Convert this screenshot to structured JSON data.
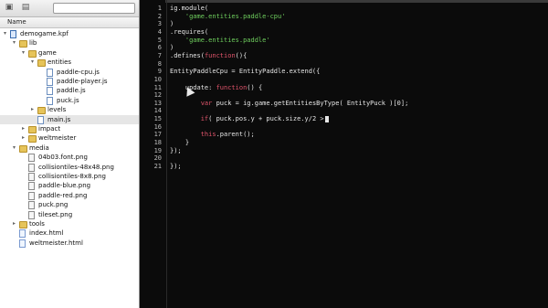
{
  "sidebar": {
    "column_header": "Name",
    "items": [
      {
        "label": "demogame.kpf",
        "type": "kpf",
        "depth": 0,
        "expanded": true
      },
      {
        "label": "lib",
        "type": "folder",
        "depth": 1,
        "expanded": true
      },
      {
        "label": "game",
        "type": "folder",
        "depth": 2,
        "expanded": true
      },
      {
        "label": "entities",
        "type": "folder",
        "depth": 3,
        "expanded": true
      },
      {
        "label": "paddle-cpu.js",
        "type": "js",
        "depth": 4
      },
      {
        "label": "paddle-player.js",
        "type": "js",
        "depth": 4
      },
      {
        "label": "paddle.js",
        "type": "js",
        "depth": 4
      },
      {
        "label": "puck.js",
        "type": "js",
        "depth": 4
      },
      {
        "label": "levels",
        "type": "folder",
        "depth": 3,
        "expanded": false
      },
      {
        "label": "main.js",
        "type": "js",
        "depth": 3,
        "selected": true
      },
      {
        "label": "impact",
        "type": "folder",
        "depth": 2,
        "expanded": false
      },
      {
        "label": "weltmeister",
        "type": "folder",
        "depth": 2,
        "expanded": false
      },
      {
        "label": "media",
        "type": "folder",
        "depth": 1,
        "expanded": true
      },
      {
        "label": "04b03.font.png",
        "type": "png",
        "depth": 2
      },
      {
        "label": "collisiontiles-48x48.png",
        "type": "png",
        "depth": 2
      },
      {
        "label": "collisiontiles-8x8.png",
        "type": "png",
        "depth": 2
      },
      {
        "label": "paddle-blue.png",
        "type": "png",
        "depth": 2
      },
      {
        "label": "paddle-red.png",
        "type": "png",
        "depth": 2
      },
      {
        "label": "puck.png",
        "type": "png",
        "depth": 2
      },
      {
        "label": "tileset.png",
        "type": "png",
        "depth": 2
      },
      {
        "label": "tools",
        "type": "folder",
        "depth": 1,
        "expanded": false
      },
      {
        "label": "index.html",
        "type": "html",
        "depth": 1
      },
      {
        "label": "weltmeister.html",
        "type": "html",
        "depth": 1
      }
    ]
  },
  "editor": {
    "lines": [
      {
        "n": "1",
        "parts": [
          [
            "plain",
            "ig.module("
          ]
        ]
      },
      {
        "n": "2",
        "parts": [
          [
            "plain",
            "    "
          ],
          [
            "str",
            "'game.entities.paddle-cpu'"
          ]
        ]
      },
      {
        "n": "3",
        "parts": [
          [
            "plain",
            ")"
          ]
        ]
      },
      {
        "n": "4",
        "parts": [
          [
            "plain",
            ".requires("
          ]
        ]
      },
      {
        "n": "5",
        "parts": [
          [
            "plain",
            "    "
          ],
          [
            "str",
            "'game.entities.paddle'"
          ]
        ]
      },
      {
        "n": "6",
        "parts": [
          [
            "plain",
            ")"
          ]
        ]
      },
      {
        "n": "7",
        "parts": [
          [
            "plain",
            ".defines("
          ],
          [
            "kw",
            "function"
          ],
          [
            "plain",
            "(){"
          ]
        ]
      },
      {
        "n": "8",
        "parts": [
          [
            "plain",
            ""
          ]
        ]
      },
      {
        "n": "9",
        "parts": [
          [
            "plain",
            "EntityPaddleCpu = EntityPaddle.extend({"
          ]
        ]
      },
      {
        "n": "10",
        "parts": [
          [
            "plain",
            ""
          ]
        ]
      },
      {
        "n": "11",
        "parts": [
          [
            "plain",
            "    update: "
          ],
          [
            "kw",
            "function"
          ],
          [
            "plain",
            "() {"
          ]
        ]
      },
      {
        "n": "12",
        "parts": [
          [
            "plain",
            ""
          ]
        ]
      },
      {
        "n": "13",
        "parts": [
          [
            "plain",
            "        "
          ],
          [
            "kw",
            "var"
          ],
          [
            "plain",
            " puck = ig.game.getEntitiesByType( EntityPuck )[0];"
          ]
        ]
      },
      {
        "n": "14",
        "parts": [
          [
            "plain",
            ""
          ]
        ]
      },
      {
        "n": "15",
        "parts": [
          [
            "plain",
            "        "
          ],
          [
            "kw",
            "if"
          ],
          [
            "plain",
            "( puck.pos.y + puck.size.y/2 >"
          ]
        ],
        "cursor": true
      },
      {
        "n": "16",
        "parts": [
          [
            "plain",
            ""
          ]
        ]
      },
      {
        "n": "17",
        "parts": [
          [
            "plain",
            "        "
          ],
          [
            "kw",
            "this"
          ],
          [
            "plain",
            ".parent();"
          ]
        ]
      },
      {
        "n": "18",
        "parts": [
          [
            "plain",
            "    }"
          ]
        ]
      },
      {
        "n": "19",
        "parts": [
          [
            "plain",
            "});"
          ]
        ]
      },
      {
        "n": "20",
        "parts": [
          [
            "plain",
            ""
          ]
        ]
      },
      {
        "n": "21",
        "parts": [
          [
            "plain",
            "});"
          ]
        ]
      }
    ]
  }
}
